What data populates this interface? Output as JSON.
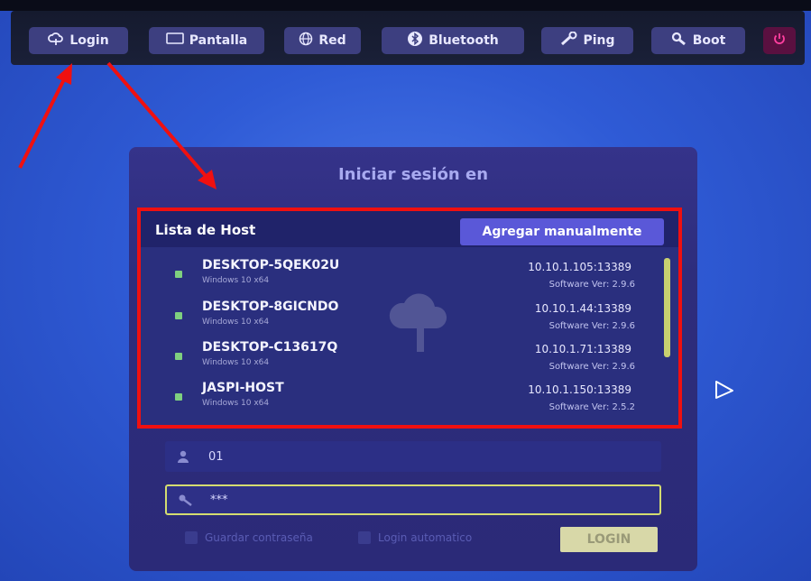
{
  "toolbar": {
    "buttons": [
      {
        "label": "Login",
        "icon": "cloud-icon"
      },
      {
        "label": "Pantalla",
        "icon": "monitor-icon"
      },
      {
        "label": "Red",
        "icon": "globe-icon"
      },
      {
        "label": "Bluetooth",
        "icon": "bluetooth-icon"
      },
      {
        "label": "Ping",
        "icon": "wrench-icon"
      },
      {
        "label": "Boot",
        "icon": "magnifier-icon"
      }
    ],
    "power_icon": "power-icon"
  },
  "login_panel": {
    "title": "Iniciar sesión en",
    "host_list": {
      "heading": "Lista de Host",
      "add_button": "Agregar manualmente",
      "hosts": [
        {
          "name": "DESKTOP-5QEK02U",
          "os": "Windows 10 x64",
          "address": "10.10.1.105:13389",
          "version": "Software Ver: 2.9.6"
        },
        {
          "name": "DESKTOP-8GICNDO",
          "os": "Windows 10 x64",
          "address": "10.10.1.44:13389",
          "version": "Software Ver: 2.9.6"
        },
        {
          "name": "DESKTOP-C13617Q",
          "os": "Windows 10 x64",
          "address": "10.10.1.71:13389",
          "version": "Software Ver: 2.9.6"
        },
        {
          "name": "JASPI-HOST",
          "os": "Windows 10 x64",
          "address": "10.10.1.150:13389",
          "version": "Software Ver: 2.5.2"
        }
      ]
    },
    "username": {
      "value": "01",
      "icon": "user-icon"
    },
    "password": {
      "value": "***",
      "icon": "key-icon"
    },
    "save_password_label": "Guardar contraseña",
    "auto_login_label": "Login automatico",
    "login_button": "LOGIN"
  },
  "colors": {
    "highlight_border": "#f01010",
    "annotation_arrow": "#f01010",
    "accent_button": "#5a58d8"
  }
}
